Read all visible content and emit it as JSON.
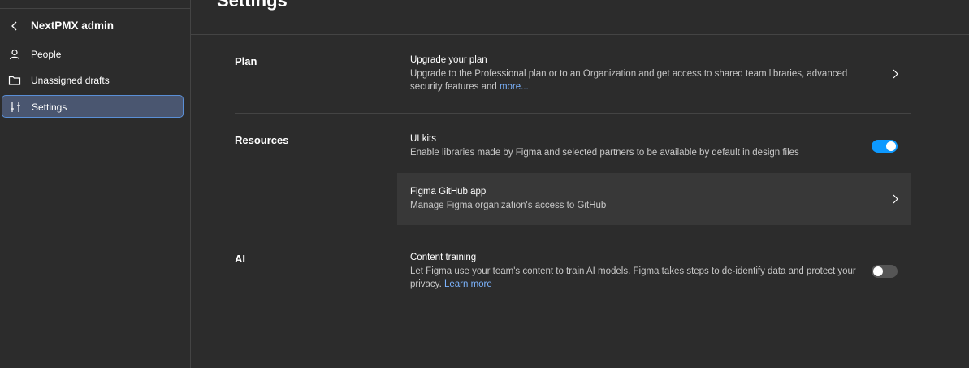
{
  "sidebar": {
    "org_name": "NextPMX admin",
    "items": [
      {
        "label": "People",
        "icon": "person-icon"
      },
      {
        "label": "Unassigned drafts",
        "icon": "folder-icon"
      },
      {
        "label": "Settings",
        "icon": "sliders-icon",
        "active": true
      }
    ]
  },
  "main": {
    "title": "Settings",
    "sections": {
      "plan": {
        "title": "Plan",
        "row_title": "Upgrade your plan",
        "row_desc": "Upgrade to the Professional plan or to an Organization and get access to shared team libraries, advanced security features and ",
        "row_link": "more..."
      },
      "resources": {
        "title": "Resources",
        "ui_kits_title": "UI kits",
        "ui_kits_desc": "Enable libraries made by Figma and selected partners to be available by default in design files",
        "ui_kits_enabled": true,
        "github_title": "Figma GitHub app",
        "github_desc": "Manage Figma organization's access to GitHub"
      },
      "ai": {
        "title": "AI",
        "row_title": "Content training",
        "row_desc": "Let Figma use your team's content to train AI models. Figma takes steps to de-identify data and protect your privacy. ",
        "row_link": "Learn more",
        "enabled": false
      }
    }
  },
  "colors": {
    "background": "#2c2c2c",
    "accent": "#0d99ff",
    "link": "#7cb4ff",
    "active_item": "#4a5670"
  }
}
